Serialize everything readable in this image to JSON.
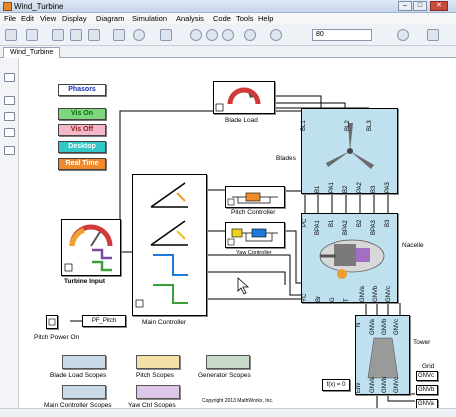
{
  "window": {
    "title": "Wind_Turbine"
  },
  "menu": [
    "File",
    "Edit",
    "View",
    "Display",
    "Diagram",
    "Simulation",
    "Analysis",
    "Code",
    "Tools",
    "Help"
  ],
  "toolbar": {
    "sim_time": "80"
  },
  "tab": {
    "label": "Wind_Turbine"
  },
  "buttons": {
    "phasors": "Phasors",
    "vis_on": "Vis On",
    "vis_off": "Vis Off",
    "desktop": "Desktop",
    "real_time": "Real Time"
  },
  "blocks": {
    "blade_load": "Blade Load",
    "blades": "Blades",
    "pitch_controller": "Pitch Controller",
    "yaw_controller": "Yaw Controller",
    "turbine_input": "Turbine Input",
    "main_controller": "Main Controller",
    "nacelle": "Nacelle",
    "tower": "Tower",
    "grid": "Grid",
    "pitch_power_on": "Pitch Power On",
    "pf_pitch": "PF_Pitch",
    "fcn": "f(x) = 0"
  },
  "ports": {
    "blades_top": [
      "BL1",
      "BL2",
      "BL3"
    ],
    "blades_bottom": [
      "B1",
      "PA1",
      "B2",
      "PA2",
      "B3",
      "PA3"
    ],
    "nacelle_top": [
      "PC",
      "BPA1",
      "B1",
      "BPA2",
      "B2",
      "BPA3",
      "B3"
    ],
    "nacelle_bottom": [
      "YC",
      "Br",
      "G",
      "T",
      "GNVa",
      "GNVb",
      "GNVc"
    ],
    "tower_top": [
      "N",
      "GNVa",
      "GNVb",
      "GNVc"
    ],
    "tower_bottom": [
      "Env",
      "GNVa",
      "GNVb",
      "GNVc"
    ],
    "grid_ports": [
      "GNVc",
      "GNVb",
      "GNVa"
    ]
  },
  "scopes": {
    "blade_load": "Blade Load Scopes",
    "pitch": "Pitch Scopes",
    "generator": "Generator Scopes",
    "main_controller": "Main Controller Scopes",
    "yaw_ctrl": "Yaw Ctrl Scopes"
  },
  "copyright": "Copyright 2013 MathWorks, Inc.",
  "colors": {
    "phasors": "#ffffff",
    "vis_on": "#7fd67f",
    "vis_off": "#f4b7c7",
    "desktop": "#33c7c7",
    "real_time": "#f08a2a",
    "subsystem": "#bfe0ee",
    "scope_blade": "#c9d9e6",
    "scope_pitch": "#f3e0a8",
    "scope_generator": "#c8dbcb",
    "scope_main": "#c9d9e6",
    "scope_yaw": "#dcc8e6"
  }
}
